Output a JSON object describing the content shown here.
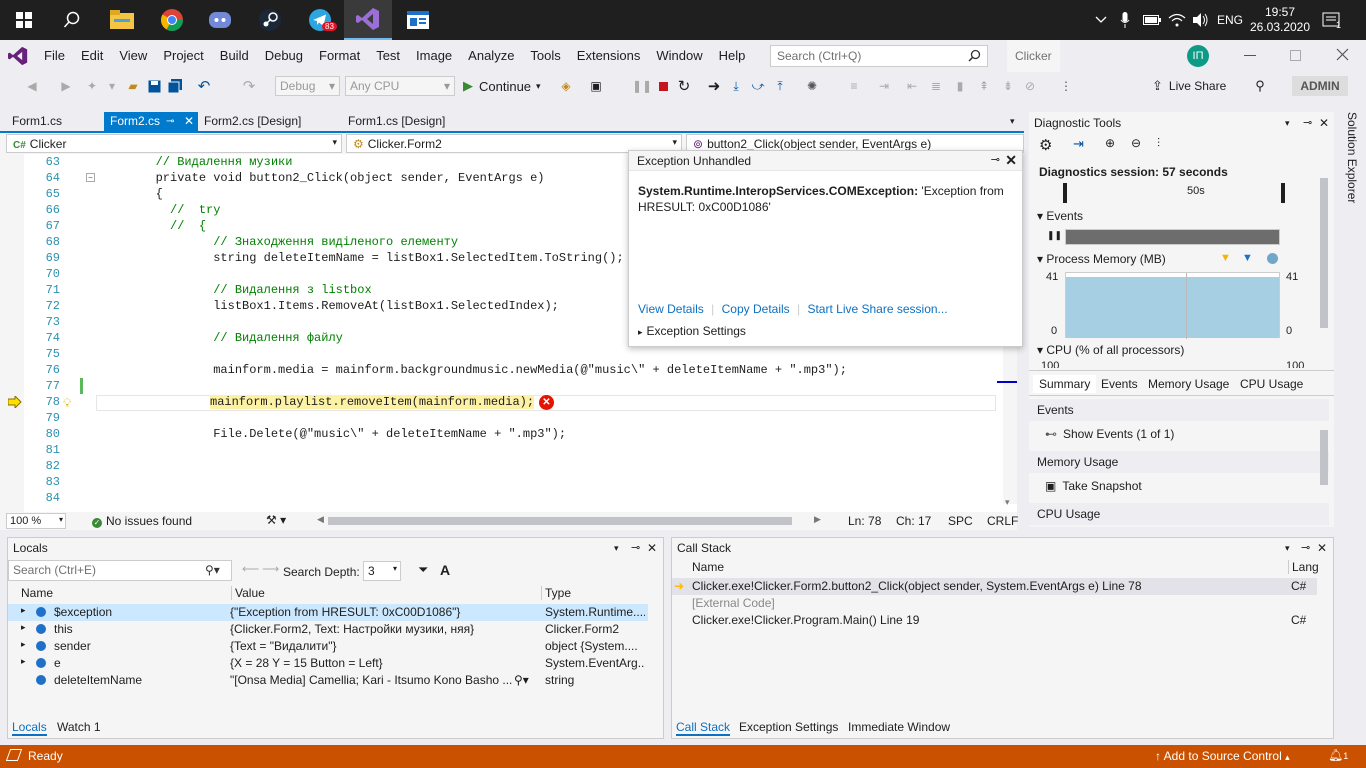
{
  "taskbar": {
    "badge": "83",
    "lang": "ENG",
    "time": "19:57",
    "date": "26.03.2020",
    "notif_count": "1"
  },
  "menu": {
    "items": [
      "File",
      "Edit",
      "View",
      "Project",
      "Build",
      "Debug",
      "Format",
      "Test",
      "Image",
      "Analyze",
      "Tools",
      "Extensions",
      "Window",
      "Help"
    ],
    "search_placeholder": "Search (Ctrl+Q)",
    "solution": "Clicker",
    "avatar_initials": "IП"
  },
  "toolbar": {
    "config": "Debug",
    "platform": "Any CPU",
    "continue": "Continue",
    "live_share": "Live Share",
    "admin": "ADMIN"
  },
  "doc_tabs": [
    "Form1.cs",
    "Form2.cs",
    "Form2.cs [Design]",
    "Form1.cs [Design]"
  ],
  "nav": {
    "project": "Clicker",
    "class": "Clicker.Form2",
    "member": "button2_Click(object sender, EventArgs e)"
  },
  "code_lines": [
    {
      "n": "63",
      "t": "        // Видалення музики"
    },
    {
      "n": "64",
      "t": "        private void button2_Click(object sender, EventArgs e)"
    },
    {
      "n": "65",
      "t": "        {"
    },
    {
      "n": "66",
      "t": "          //  try"
    },
    {
      "n": "67",
      "t": "          //  {"
    },
    {
      "n": "68",
      "t": "                // Знаходження виділеного елементу"
    },
    {
      "n": "69",
      "t": "                string deleteItemName = listBox1.SelectedItem.ToString();"
    },
    {
      "n": "70",
      "t": ""
    },
    {
      "n": "71",
      "t": "                // Видалення з listbox"
    },
    {
      "n": "72",
      "t": "                listBox1.Items.RemoveAt(listBox1.SelectedIndex);"
    },
    {
      "n": "73",
      "t": ""
    },
    {
      "n": "74",
      "t": "                // Видалення файлу"
    },
    {
      "n": "75",
      "t": ""
    },
    {
      "n": "76",
      "t": "                mainform.media = mainform.backgroundmusic.newMedia(@\"music\\\" + deleteItemName + \".mp3\");"
    },
    {
      "n": "77",
      "t": ""
    },
    {
      "n": "78",
      "t": "                mainform.playlist.removeItem(mainform.media);"
    },
    {
      "n": "79",
      "t": ""
    },
    {
      "n": "80",
      "t": "                File.Delete(@\"music\\\" + deleteItemName + \".mp3\");"
    },
    {
      "n": "81",
      "t": ""
    },
    {
      "n": "82",
      "t": ""
    },
    {
      "n": "83",
      "t": ""
    },
    {
      "n": "84",
      "t": ""
    }
  ],
  "exception": {
    "title": "Exception Unhandled",
    "type": "System.Runtime.InteropServices.COMException:",
    "message": " 'Exception from HRESULT: 0xC00D1086'",
    "link_view": "View Details",
    "link_copy": "Copy Details",
    "link_share": "Start Live Share session...",
    "settings": "Exception Settings"
  },
  "editor_status": {
    "zoom": "100 %",
    "issues": "No issues found",
    "ln": "Ln: 78",
    "ch": "Ch: 17",
    "spc": "SPC",
    "eol": "CRLF"
  },
  "diag": {
    "title": "Diagnostic Tools",
    "session": "Diagnostics session: 57 seconds",
    "timeline_label": "50s",
    "events": "Events",
    "memory": "Process Memory (MB)",
    "mem_max": "41",
    "mem_min": "0",
    "mem_max_r": "41",
    "mem_min_r": "0",
    "cpu": "CPU (% of all processors)",
    "cpu_max": "100",
    "cpu_max_r": "100",
    "tabs": [
      "Summary",
      "Events",
      "Memory Usage",
      "CPU Usage"
    ],
    "sec_events": "Events",
    "show_events": "Show Events (1 of 1)",
    "sec_memory": "Memory Usage",
    "take_snapshot": "Take Snapshot",
    "sec_cpu": "CPU Usage"
  },
  "locals": {
    "title": "Locals",
    "search_placeholder": "Search (Ctrl+E)",
    "depth_label": "Search Depth:",
    "depth": "3",
    "headers": [
      "Name",
      "Value",
      "Type"
    ],
    "rows": [
      {
        "name": "$exception",
        "value": "{\"Exception from HRESULT: 0xC00D1086\"}",
        "type": "System.Runtime...."
      },
      {
        "name": "this",
        "value": "{Clicker.Form2, Text: Настройки музики, няя}",
        "type": "Clicker.Form2"
      },
      {
        "name": "sender",
        "value": "{Text = \"Видалити\"}",
        "type": "object {System...."
      },
      {
        "name": "e",
        "value": "{X = 28 Y = 15 Button = Left}",
        "type": "System.EventArg..."
      },
      {
        "name": "deleteItemName",
        "value": "\"[Onsa Media] Camellia; Kari - Itsumo Kono Basho ...",
        "type": "string"
      }
    ],
    "tab1": "Locals",
    "tab2": "Watch 1"
  },
  "callstack": {
    "title": "Call Stack",
    "headers": [
      "Name",
      "Lang"
    ],
    "rows": [
      {
        "name": "Clicker.exe!Clicker.Form2.button2_Click(object sender, System.EventArgs e) Line 78",
        "lang": "C#"
      },
      {
        "name": "[External Code]",
        "lang": ""
      },
      {
        "name": "Clicker.exe!Clicker.Program.Main() Line 19",
        "lang": "C#"
      }
    ],
    "tab1": "Call Stack",
    "tab2": "Exception Settings",
    "tab3": "Immediate Window"
  },
  "status": {
    "ready": "Ready",
    "source_control": "Add to Source Control",
    "notif": "1"
  },
  "side": {
    "solution_explorer": "Solution Explorer"
  }
}
